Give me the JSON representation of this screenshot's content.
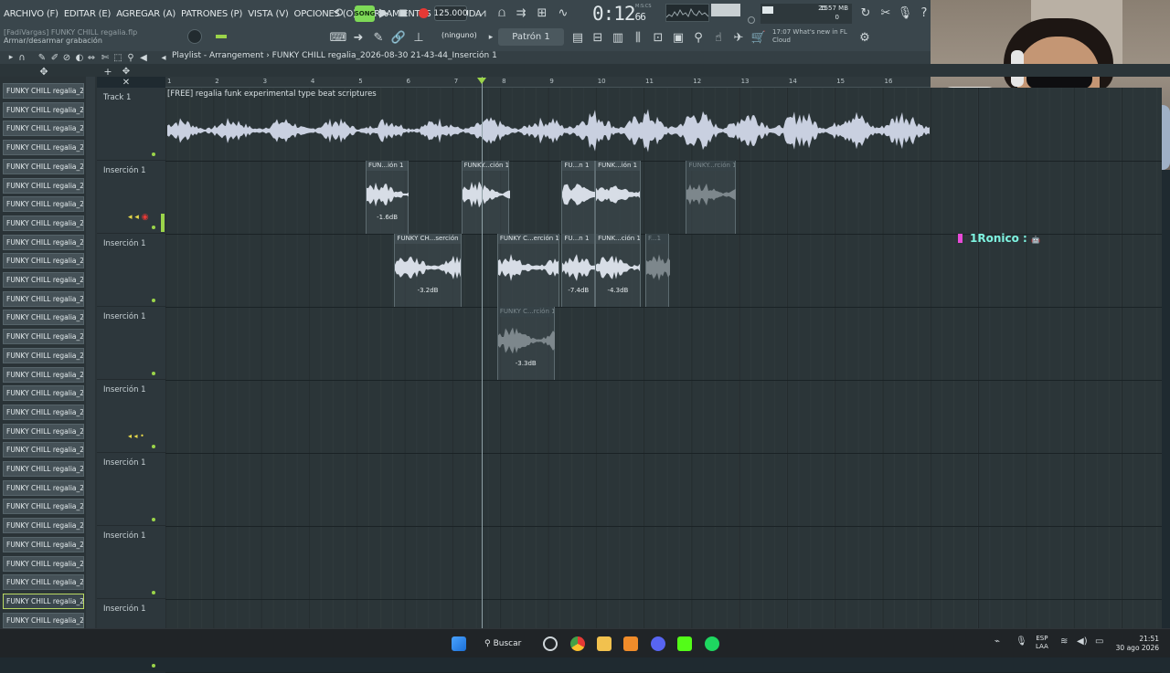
{
  "menu": [
    "ARCHIVO (F)",
    "EDITAR (E)",
    "AGREGAR (A)",
    "PATRONES (P)",
    "VISTA (V)",
    "OPCIONES (O)",
    "HERRAMIENTAS (T)",
    "AYUDA"
  ],
  "hint": {
    "file": "[FadiVargas] FUNKY CHILL regalia.flp",
    "text": "Armar/desarmar grabación"
  },
  "transport": {
    "song_label": "SONG",
    "tempo": "125.000",
    "time": "0:12",
    "time_ms": "66",
    "time_ms_label": "M:S:CS"
  },
  "resources": {
    "voices": "25",
    "memory": "1557 MB",
    "voices_zero": "0"
  },
  "pattern": {
    "none_label": "(ninguno)",
    "current": "Patrón 1"
  },
  "news": {
    "time": "17:07",
    "text": "What's new in FL",
    "sub": "Cloud"
  },
  "playlist": {
    "title": "Playlist - Arrangement › FUNKY CHILL regalia_2026-08-30 21-43-44_Inserción 1"
  },
  "picker_items": [
    "FUNKY CHILL regalia_202...",
    "FUNKY CHILL regalia_202...",
    "FUNKY CHILL regalia_202...",
    "FUNKY CHILL regalia_202...",
    "FUNKY CHILL regalia_202...",
    "FUNKY CHILL regalia_202...",
    "FUNKY CHILL regalia_202...",
    "FUNKY CHILL regalia_202...",
    "FUNKY CHILL regalia_202...",
    "FUNKY CHILL regalia_202...",
    "FUNKY CHILL regalia_202...",
    "FUNKY CHILL regalia_202...",
    "FUNKY CHILL regalia_202...",
    "FUNKY CHILL regalia_202...",
    "FUNKY CHILL regalia_202...",
    "FUNKY CHILL regalia_202...",
    "FUNKY CHILL regalia_202...",
    "FUNKY CHILL regalia_202...",
    "FUNKY CHILL regalia_202...",
    "FUNKY CHILL regalia_202...",
    "FUNKY CHILL regalia_202...",
    "FUNKY CHILL regalia_202...",
    "FUNKY CHILL regalia_202...",
    "FUNKY CHILL regalia_202...",
    "FUNKY CHILL regalia_202...",
    "FUNKY CHILL regalia_202...",
    "FUNKY CHILL regalia_202...",
    "FUNKY CHILL regalia_202...",
    "FUNKY CHILL regalia_202..."
  ],
  "tracks": [
    "Track 1",
    "Inserción 1",
    "Inserción 1",
    "Inserción 1",
    "Inserción 1",
    "Inserción 1",
    "Inserción 1",
    "Inserción 1"
  ],
  "track1_clip": "[FREE] regalia  funk  experimental type beat  scriptures",
  "bar_numbers": [
    "1",
    "2",
    "3",
    "4",
    "5",
    "6",
    "7",
    "8",
    "9",
    "10",
    "11",
    "12",
    "13",
    "14",
    "15",
    "16"
  ],
  "clips": [
    {
      "row": 1,
      "start_bar": 5.15,
      "length_bars": 0.9,
      "label": "FUN...ión 1",
      "gain": "-1.6dB",
      "muted": false
    },
    {
      "row": 1,
      "start_bar": 7.15,
      "length_bars": 1.0,
      "label": "FUNKY...ción 1",
      "gain": "",
      "muted": false
    },
    {
      "row": 1,
      "start_bar": 9.25,
      "length_bars": 0.7,
      "label": "FU...n 1",
      "gain": "",
      "muted": false
    },
    {
      "row": 1,
      "start_bar": 9.95,
      "length_bars": 0.95,
      "label": "FUNK...ión 1",
      "gain": "",
      "muted": false
    },
    {
      "row": 1,
      "start_bar": 11.85,
      "length_bars": 1.05,
      "label": "FUNKY...rción 1",
      "gain": "",
      "muted": true
    },
    {
      "row": 2,
      "start_bar": 5.75,
      "length_bars": 1.4,
      "label": "FUNKY CH...serción 1",
      "gain": "-3.2dB",
      "muted": false
    },
    {
      "row": 2,
      "start_bar": 7.9,
      "length_bars": 1.3,
      "label": "FUNKY C...erción 1",
      "gain": "",
      "muted": false
    },
    {
      "row": 2,
      "start_bar": 9.25,
      "length_bars": 0.7,
      "label": "FU...n 1",
      "gain": "-7.4dB",
      "muted": false
    },
    {
      "row": 2,
      "start_bar": 9.95,
      "length_bars": 0.95,
      "label": "FUNK...ción 1",
      "gain": "-4.3dB",
      "muted": false
    },
    {
      "row": 2,
      "start_bar": 11.0,
      "length_bars": 0.5,
      "label": "F...1",
      "gain": "",
      "muted": true
    },
    {
      "row": 3,
      "start_bar": 7.9,
      "length_bars": 1.2,
      "label": "FUNKY C...rción 1",
      "gain": "-3.3dB",
      "muted": true
    }
  ],
  "chat": {
    "user": "1Ronico :"
  },
  "taskbar": {
    "search": "Buscar",
    "lang1": "ESP",
    "lang2": "LAA",
    "time": "21:51",
    "date": "30 ago 2026"
  },
  "colors": {
    "accent_green": "#9bd44a",
    "song_green": "#7ed957",
    "record_red": "#e53935",
    "chat_cyan": "#7ef3e0"
  }
}
